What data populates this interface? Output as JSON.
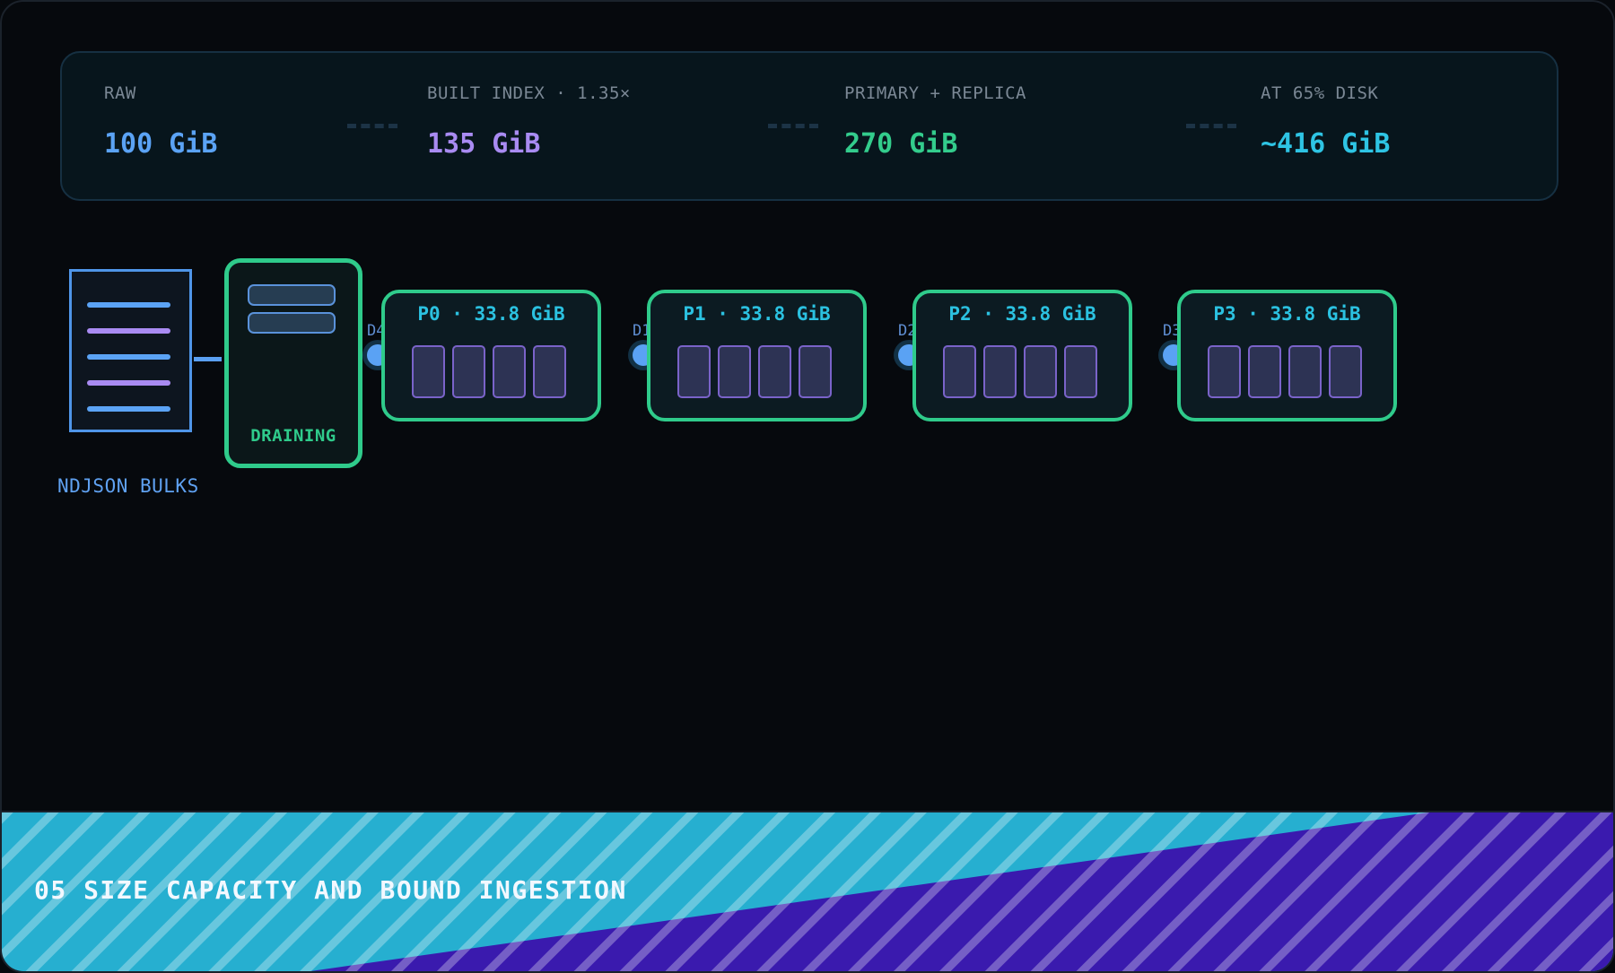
{
  "colors": {
    "background": "#06090d",
    "raw": "#5ba3f5",
    "built": "#a98bf2",
    "replica": "#33cc8c",
    "disk": "#2ec4e4",
    "node_border": "#2fcb8b",
    "banner_cyan": "#26afd0",
    "banner_purple": "#3a1aae"
  },
  "stats": [
    {
      "label": "RAW",
      "value": "100 GiB",
      "color": "#5ba3f5"
    },
    {
      "label": "BUILT INDEX · 1.35×",
      "value": "135 GiB",
      "color": "#a98bf2"
    },
    {
      "label": "PRIMARY + REPLICA",
      "value": "270 GiB",
      "color": "#33cc8c"
    },
    {
      "label": "AT 65% DISK",
      "value": "~416 GiB",
      "color": "#2ec4e4"
    }
  ],
  "source": {
    "caption": "NDJSON BULKS",
    "icon": "document-icon"
  },
  "queue": {
    "label": "DRAINING"
  },
  "partitions": [
    {
      "title": "P0 · 33.8 GiB",
      "connector": "D4"
    },
    {
      "title": "P1 · 33.8 GiB",
      "connector": "D1"
    },
    {
      "title": "P2 · 33.8 GiB",
      "connector": "D2"
    },
    {
      "title": "P3 · 33.8 GiB",
      "connector": "D3"
    }
  ],
  "banner": {
    "title": "05 SIZE CAPACITY AND BOUND INGESTION"
  }
}
